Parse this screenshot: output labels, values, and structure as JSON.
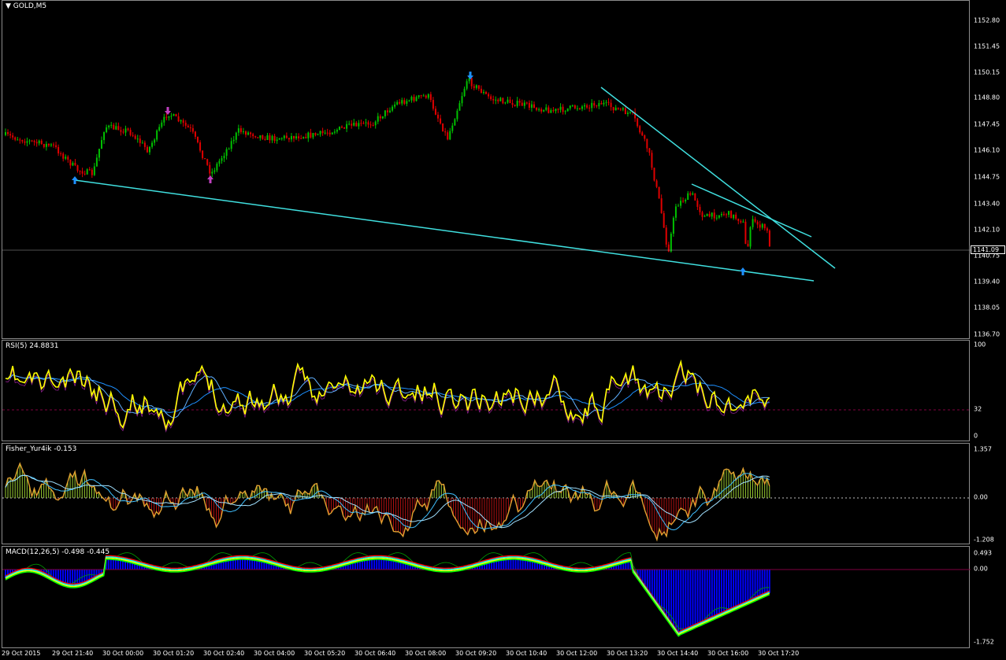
{
  "main": {
    "title": "GOLD,M5",
    "current_price": "1141.09",
    "price_ticks": [
      "1152.80",
      "1151.45",
      "1150.15",
      "1148.80",
      "1147.45",
      "1146.10",
      "1144.75",
      "1143.40",
      "1142.10",
      "1140.75",
      "1139.40",
      "1138.05",
      "1136.70"
    ],
    "colors": {
      "bull": "#00c000",
      "bear": "#e00000",
      "trendline": "#40e0e0",
      "arrow_blue": "#1e90ff",
      "arrow_purple": "#c040c0"
    }
  },
  "rsi": {
    "title": "RSI(5) 24.8831",
    "ticks": [
      "100",
      "32",
      "0"
    ],
    "colors": {
      "main": "#ffff00",
      "level": "#800040"
    }
  },
  "fisher": {
    "title": "Fisher_Yur4ik -0.153",
    "ticks": [
      "1.357",
      "0.00",
      "-1.208"
    ],
    "colors": {
      "pos": "#9acd32",
      "neg": "#e07020",
      "lines": "#40c0ff"
    }
  },
  "macd": {
    "title": "MACD(12,26,5) -0.498 -0.445",
    "ticks": [
      "0.493",
      "0.00",
      "-1.752"
    ],
    "colors": {
      "histogram": "#0000ff"
    }
  },
  "time_axis": [
    "29 Oct 2015",
    "29 Oct 21:40",
    "30 Oct 00:00",
    "30 Oct 01:20",
    "30 Oct 02:40",
    "30 Oct 04:00",
    "30 Oct 05:20",
    "30 Oct 06:40",
    "30 Oct 08:00",
    "30 Oct 09:20",
    "30 Oct 10:40",
    "30 Oct 12:00",
    "30 Oct 13:20",
    "30 Oct 14:40",
    "30 Oct 16:00",
    "30 Oct 17:20"
  ]
}
